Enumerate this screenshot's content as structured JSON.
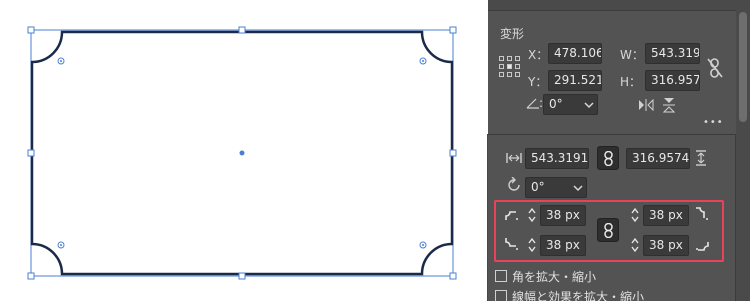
{
  "canvas": {
    "shape_stroke_color": "#1c2a4a",
    "selection_color": "#4a7fd4"
  },
  "transform": {
    "title": "変形",
    "x_label": "X：",
    "x_value": "478.106",
    "y_label": "Y：",
    "y_value": "291.521",
    "w_label": "W：",
    "w_value": "543.319",
    "h_label": "H：",
    "h_value": "316.9574",
    "angle_value": "0°",
    "more_label": "•••"
  },
  "shape_props": {
    "width_value": "543.3191",
    "height_value": "316.9574",
    "rotation_value": "0°",
    "corner_tl": "38 px",
    "corner_tr": "38 px",
    "corner_bl": "38 px",
    "corner_br": "38 px",
    "scale_corners_label": "角を拡大・縮小",
    "scale_strokes_label": "線幅と効果を拡大・縮小",
    "highlight_color": "#e8435a"
  }
}
